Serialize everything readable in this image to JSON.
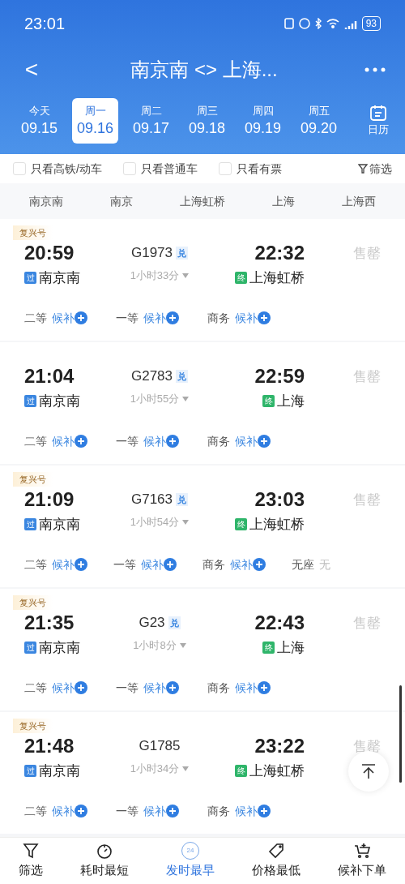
{
  "status_bar": {
    "time": "23:01",
    "battery": "93"
  },
  "header": {
    "title": "南京南 <> 上海...",
    "back": "<"
  },
  "dates": [
    {
      "weekday": "今天",
      "date": "09.15",
      "selected": false
    },
    {
      "weekday": "周一",
      "date": "09.16",
      "selected": true
    },
    {
      "weekday": "周二",
      "date": "09.17",
      "selected": false
    },
    {
      "weekday": "周三",
      "date": "09.18",
      "selected": false
    },
    {
      "weekday": "周四",
      "date": "09.19",
      "selected": false
    },
    {
      "weekday": "周五",
      "date": "09.20",
      "selected": false
    }
  ],
  "calendar": "日历",
  "filters": [
    {
      "label": "只看高铁/动车",
      "checked": false
    },
    {
      "label": "只看普通车",
      "checked": false
    },
    {
      "label": "只看有票",
      "checked": false
    }
  ],
  "filter_button": "筛选",
  "stations": [
    {
      "label": "南京南",
      "selected": false
    },
    {
      "label": "南京",
      "selected": false
    },
    {
      "label": "上海虹桥",
      "selected": false
    },
    {
      "label": "上海",
      "selected": false
    },
    {
      "label": "上海西",
      "selected": false
    }
  ],
  "trains": [
    {
      "tag": "复兴号",
      "depart": "20:59",
      "number": "G1973",
      "badge": "兑",
      "arrive": "22:32",
      "from_mark": "过",
      "from": "南京南",
      "duration": "1小时33分",
      "to_mark": "终",
      "to": "上海虹桥",
      "status": "售罄",
      "seats": [
        {
          "class": "二等",
          "status": "候补",
          "kind": "waitlist"
        },
        {
          "class": "一等",
          "status": "候补",
          "kind": "waitlist"
        },
        {
          "class": "商务",
          "status": "候补",
          "kind": "waitlist"
        }
      ]
    },
    {
      "depart": "21:04",
      "number": "G2783",
      "badge": "兑",
      "arrive": "22:59",
      "from_mark": "过",
      "from": "南京南",
      "duration": "1小时55分",
      "to_mark": "终",
      "to": "上海",
      "status": "售罄",
      "seats": [
        {
          "class": "二等",
          "status": "候补",
          "kind": "waitlist"
        },
        {
          "class": "一等",
          "status": "候补",
          "kind": "waitlist"
        },
        {
          "class": "商务",
          "status": "候补",
          "kind": "waitlist"
        }
      ]
    },
    {
      "tag": "复兴号",
      "depart": "21:09",
      "number": "G7163",
      "badge": "兑",
      "arrive": "23:03",
      "from_mark": "过",
      "from": "南京南",
      "duration": "1小时54分",
      "to_mark": "终",
      "to": "上海虹桥",
      "status": "售罄",
      "seats": [
        {
          "class": "二等",
          "status": "候补",
          "kind": "waitlist"
        },
        {
          "class": "一等",
          "status": "候补",
          "kind": "waitlist"
        },
        {
          "class": "商务",
          "status": "候补",
          "kind": "waitlist"
        },
        {
          "class": "无座",
          "status": "无",
          "kind": "none"
        }
      ]
    },
    {
      "tag": "复兴号",
      "depart": "21:35",
      "number": "G23",
      "badge": "兑",
      "arrive": "22:43",
      "from_mark": "过",
      "from": "南京南",
      "duration": "1小时8分",
      "to_mark": "终",
      "to": "上海",
      "status": "售罄",
      "seats": [
        {
          "class": "二等",
          "status": "候补",
          "kind": "waitlist"
        },
        {
          "class": "一等",
          "status": "候补",
          "kind": "waitlist"
        },
        {
          "class": "商务",
          "status": "候补",
          "kind": "waitlist"
        }
      ]
    },
    {
      "tag": "复兴号",
      "depart": "21:48",
      "number": "G1785",
      "arrive": "23:22",
      "from_mark": "过",
      "from": "南京南",
      "duration": "1小时34分",
      "to_mark": "终",
      "to": "上海虹桥",
      "status": "售罄",
      "seats": [
        {
          "class": "二等",
          "status": "候补",
          "kind": "waitlist"
        },
        {
          "class": "一等",
          "status": "候补",
          "kind": "waitlist"
        },
        {
          "class": "商务",
          "status": "候补",
          "kind": "waitlist"
        }
      ]
    }
  ],
  "bottom_tabs": [
    {
      "label": "筛选",
      "kind": "filter",
      "selected": false
    },
    {
      "label": "耗时最短",
      "kind": "timer",
      "selected": false
    },
    {
      "label": "发时最早",
      "kind": "clock",
      "icon_text": "24",
      "selected": true
    },
    {
      "label": "价格最低",
      "kind": "tag",
      "selected": false
    },
    {
      "label": "候补下单",
      "kind": "cart",
      "selected": false
    }
  ]
}
